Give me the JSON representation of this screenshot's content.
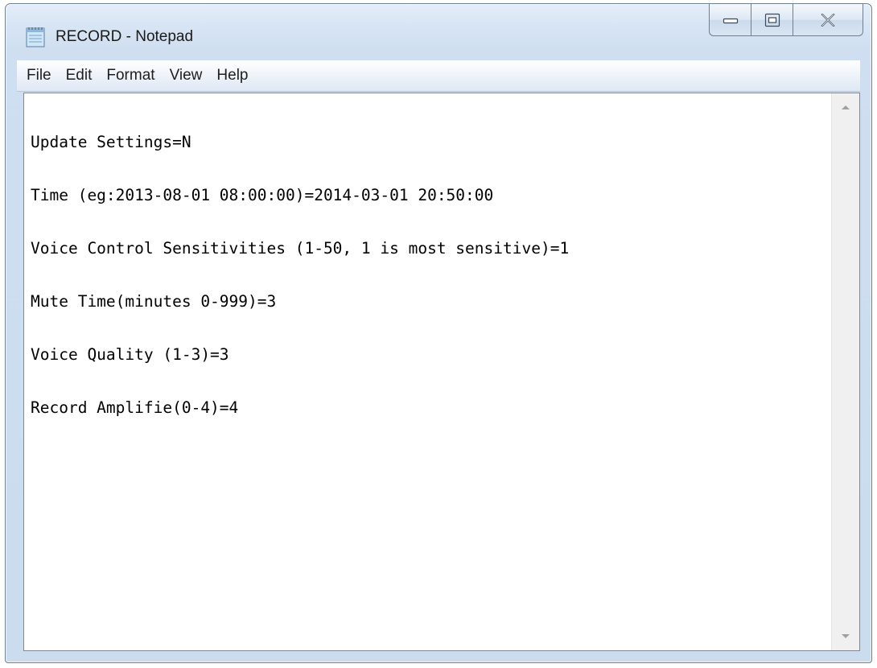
{
  "window": {
    "title": "RECORD - Notepad",
    "app_icon": "notepad-icon"
  },
  "caption_buttons": {
    "minimize_icon": "minimize-icon",
    "maximize_icon": "maximize-icon",
    "close_icon": "close-icon"
  },
  "menu": {
    "items": [
      {
        "label": "File"
      },
      {
        "label": "Edit"
      },
      {
        "label": "Format"
      },
      {
        "label": "View"
      },
      {
        "label": "Help"
      }
    ]
  },
  "document": {
    "lines": [
      "Update Settings=N",
      "Time (eg:2013-08-01 08:00:00)=2014-03-01 20:50:00",
      "Voice Control Sensitivities (1-50, 1 is most sensitive)=1",
      "Mute Time(minutes 0-999)=3",
      "Voice Quality (1-3)=3",
      "Record Amplifie(0-4)=4"
    ]
  },
  "scrollbar": {
    "up_icon": "scroll-up-arrow-icon",
    "down_icon": "scroll-down-arrow-icon"
  },
  "colors": {
    "title_bar": "#d6e4f3",
    "menu_bar": "#f0f4fa",
    "editor_background": "#ffffff",
    "text": "#000000"
  }
}
